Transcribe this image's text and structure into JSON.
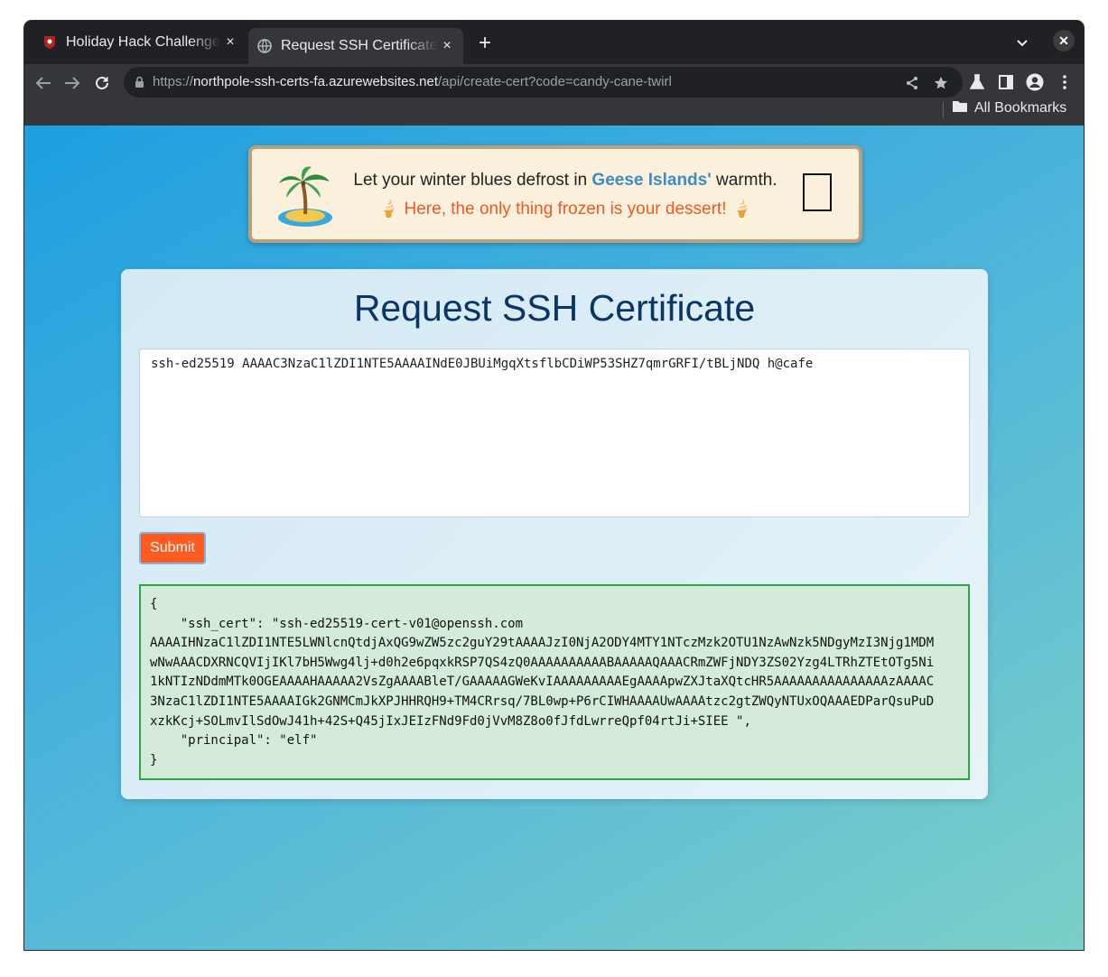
{
  "browser": {
    "tabs": [
      {
        "title": "Holiday Hack Challenge",
        "close_label": "×"
      },
      {
        "title": "Request SSH Certificate",
        "close_label": "×"
      }
    ],
    "new_tab_label": "+",
    "window_close_label": "✕",
    "url": {
      "scheme": "https://",
      "host": "northpole-ssh-certs-fa.azurewebsites.net",
      "path": "/api/create-cert?code=candy-cane-twirl"
    },
    "bookmarks": {
      "all_label": "All Bookmarks"
    }
  },
  "banner": {
    "line1_prefix": "Let your winter blues defrost in ",
    "line1_highlight": "Geese Islands'",
    "line1_suffix": " warmth.",
    "line2": "🍦 Here, the only thing frozen is your dessert! 🍦"
  },
  "card": {
    "title": "Request SSH Certificate",
    "textarea_value": "ssh-ed25519 AAAAC3NzaC1lZDI1NTE5AAAAINdE0JBUiMgqXtsflbCDiWP53SHZ7qmrGRFI/tBLjNDQ h@cafe",
    "submit_label": "Submit",
    "result_text": "{\n    \"ssh_cert\": \"ssh-ed25519-cert-v01@openssh.com\nAAAAIHNzaC1lZDI1NTE5LWNlcnQtdjAxQG9wZW5zc2guY29tAAAAJzI0NjA2ODY4MTY1NTczMzk2OTU1NzAwNzk5NDgyMzI3Njg1MDM\nwNwAAACDXRNCQVIjIKl7bH5Wwg4lj+d0h2e6pqxkRSP7QS4zQ0AAAAAAAAAABAAAAAQAAACRmZWFjNDY3ZS02Yzg4LTRhZTEtOTg5Ni\n1kNTIzNDdmMTk0OGEAAAAHAAAAA2VsZgAAAABleT/GAAAAAGWeKvIAAAAAAAAAEgAAAApwZXJtaXQtcHR5AAAAAAAAAAAAAAAzAAAAC\n3NzaC1lZDI1NTE5AAAAIGk2GNMCmJkXPJHHRQH9+TM4CRrsq/7BL0wp+P6rCIWHAAAAUwAAAAtzc2gtZWQyNTUxOQAAAEDParQsuPuD\nxzkKcj+SOLmvIlSdOwJ41h+42S+Q45jIxJEIzFNd9Fd0jVvM8Z8o0fJfdLwrreQpf04rtJi+SIEE \",\n    \"principal\": \"elf\"\n}"
  }
}
